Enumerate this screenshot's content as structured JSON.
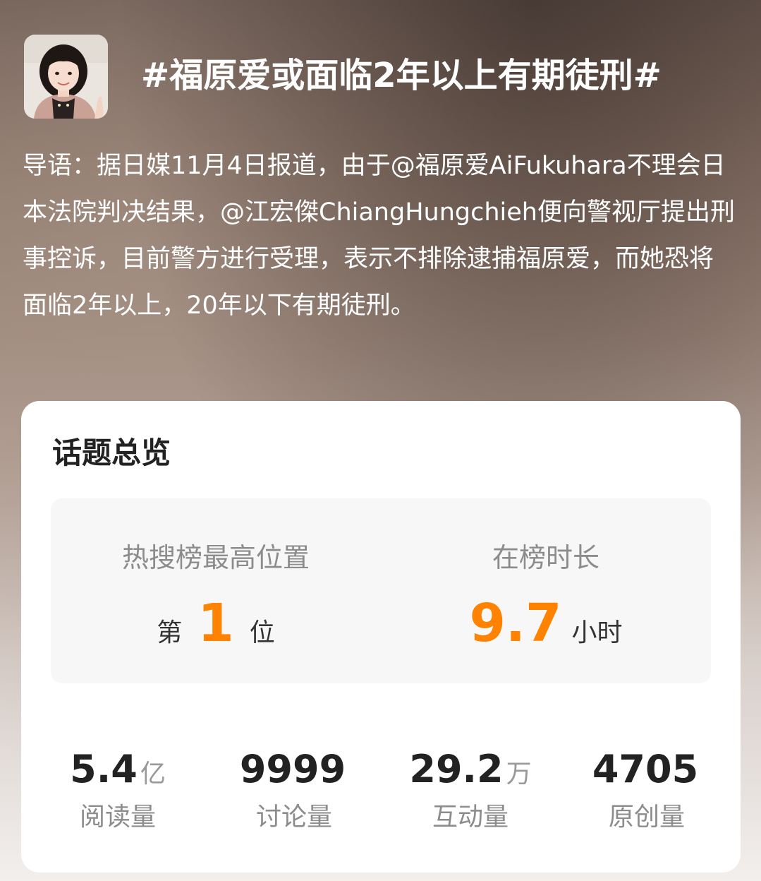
{
  "topic": {
    "avatar_icon": "avatar-photo",
    "title": "#福原爱或面临2年以上有期徒刑#",
    "lead": "导语：据日媒11月4日报道，由于@福原爱AiFukuhara不理会日本法院判决结果，@江宏傑ChiangHungchieh便向警视厅提出刑事控诉，目前警方进行受理，表示不排除逮捕福原爱，而她恐将面临2年以上，20年以下有期徒刑。"
  },
  "overview": {
    "title": "话题总览",
    "rank": {
      "label": "热搜榜最高位置",
      "prefix": "第",
      "value": "1",
      "suffix": "位"
    },
    "duration": {
      "label": "在榜时长",
      "value": "9.7",
      "unit": "小时"
    },
    "stats": [
      {
        "value": "5.4",
        "unit": "亿",
        "label": "阅读量"
      },
      {
        "value": "9999",
        "unit": "",
        "label": "讨论量"
      },
      {
        "value": "29.2",
        "unit": "万",
        "label": "互动量"
      },
      {
        "value": "4705",
        "unit": "",
        "label": "原创量"
      }
    ]
  },
  "colors": {
    "accent": "#ff8200",
    "card_bg": "#ffffff",
    "box_bg": "#f7f7f7"
  }
}
